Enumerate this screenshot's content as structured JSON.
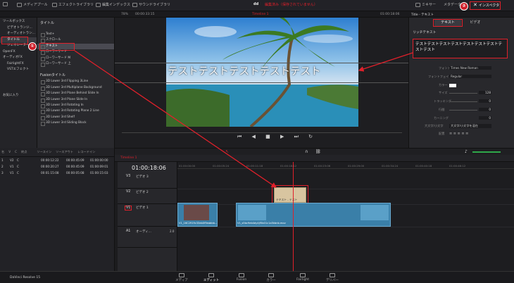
{
  "topbar": {
    "media_pool": "メディアプール",
    "effects_library": "エフェクトライブラリ",
    "edit_index": "編集インデックス",
    "sound_library": "サウンドライブラリ",
    "project": "dd",
    "status": "編集済み（保存されていません）",
    "mixer": "ミキサー",
    "metadata": "メタデータ",
    "inspector": "インスペクタ"
  },
  "subbar": {
    "zoom": "78%",
    "timecode": "00:00:33:15",
    "timeline_name": "Timeline 1",
    "duration": "01:00:18:06",
    "inspector_title": "Title - テキスト"
  },
  "tree": {
    "toolbox": "ツールボックス",
    "video_transition": "ビデオトランジ...",
    "audio_transition": "オーディオトラン...",
    "titles": "タイトル",
    "generators": "ジェネレーター",
    "openfx": "OpenFX",
    "audio_fx": "オーディオFX",
    "fairlight": "FairlightFX",
    "vst": "VSTエフェクト",
    "favorites": "お気に入り"
  },
  "titles_section": "タイトル",
  "title_items": [
    "Text+",
    "スクロール",
    "テキスト",
    "ローワーサード",
    "ローワーサード M",
    "ローワーサード 上"
  ],
  "fusion_section": "Fusionタイトル",
  "fusion_items": [
    "3D Lower 3rd Flipping 3Line",
    "3D Lower 3rd Multiplane Background",
    "3D Lower 3rd Plane Behind Slide In",
    "3D Lower 3rd Plane Slide In",
    "3D Lower 3rd Rotating In",
    "3D Lower 3rd Rotating Plane 2 Line",
    "3D Lower 3rd Shelf",
    "3D Lower 3rd Sliding Block"
  ],
  "viewer": {
    "overlay_text": "テストテストテストテストテスト"
  },
  "inspector": {
    "tab_text": "テキスト",
    "tab_video": "ビデオ",
    "section": "リッチテキスト",
    "text_value": "テストテストテストテストテストテストテストテストテスト",
    "font_label": "フォント",
    "font_value": "Times New Roman",
    "face_label": "フォントフェイス",
    "face_value": "Regular",
    "color_label": "カラー",
    "size_label": "サイズ",
    "size_value": "128",
    "tracking_label": "トラッキング",
    "tracking_value": "0",
    "line_label": "行間",
    "line_value": "0",
    "kerning_label": "カーニング",
    "kerning_value": "0",
    "case_label": "大文字/小文字",
    "case_value": "大文字/小文字を混在",
    "align_label": "配置"
  },
  "mediapool": {
    "cols": [
      "名",
      "V",
      "C",
      "終点",
      "ソースイン",
      "ソースアウト",
      "レコードイン"
    ],
    "rows": [
      [
        "1",
        "V2",
        "C",
        "",
        "00:00:12:22",
        "00:00:45:09",
        "01:00:00:00"
      ],
      [
        "2",
        "V1",
        "C",
        "",
        "00:00:20:27",
        "00:00:45:09",
        "01:00:09:01"
      ],
      [
        "3",
        "V1",
        "C",
        "",
        "00:01:15:08",
        "00:00:05:08",
        "01:00:15:03"
      ]
    ]
  },
  "timeline": {
    "tab": "Timeline 1",
    "timecode": "01:00:18:06",
    "ruler": [
      "01:00:00:00",
      "01:00:05:24",
      "01:00:11:18",
      "01:00:18:12",
      "01:00:23:06",
      "01:00:29:00",
      "01:00:34:24",
      "01:00:40:18",
      "01:00:46:12"
    ],
    "tracks": [
      {
        "id": "V3",
        "name": "ビデオ 3"
      },
      {
        "id": "V2",
        "name": "ビデオ 2"
      },
      {
        "id": "V1",
        "name": "ビデオ 1"
      },
      {
        "id": "A1",
        "name": "オーディ...",
        "ch": "2.0"
      }
    ],
    "clip_title": "テキスト - テスト",
    "clip1": "V1_16C2919c33eb0f9eabbb...",
    "clip2": "V1_s5bc9eb4dy4jf5b01c1a5kbnb.mov",
    "empty": "クリップなし"
  },
  "bottom": {
    "app": "DaVinci Resolve 15",
    "nav": [
      "メディア",
      "エディット",
      "Fusion",
      "カラー",
      "Fairlight",
      "デリバー"
    ]
  },
  "badges": [
    "①",
    "②"
  ],
  "colors": {
    "accent_red": "#e0202a",
    "timeline_text_clip": "#d8c5a0",
    "clip": "#3a7fa8"
  }
}
